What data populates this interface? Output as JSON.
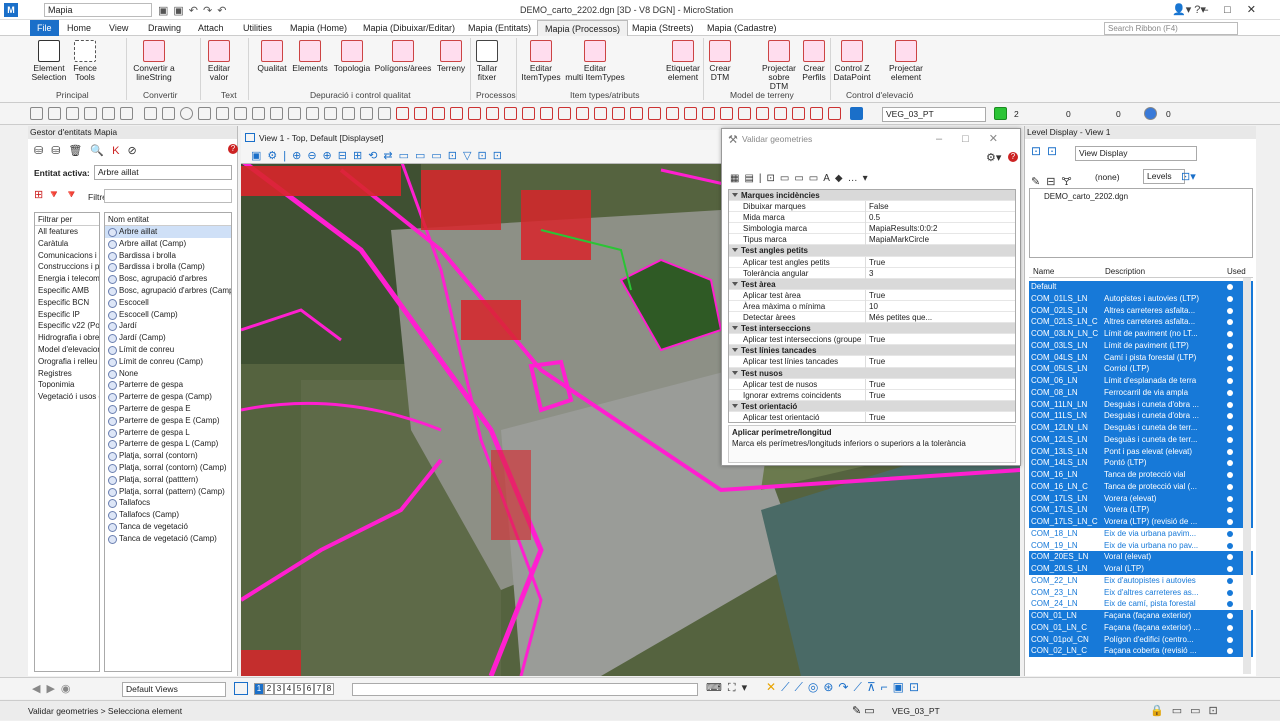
{
  "app": {
    "title": "DEMO_carto_2202.dgn [3D - V8 DGN] - MicroStation",
    "workflow": "Mapia",
    "search_placeholder": "Search Ribbon (F4)"
  },
  "tabs": [
    "File",
    "Home",
    "View",
    "Drawing",
    "Attach",
    "Utilities",
    "Mapia (Home)",
    "Mapia (Dibuixar/Editar)",
    "Mapia (Entitats)",
    "Mapia (Processos)",
    "Mapia (Streets)",
    "Mapia (Cadastre)"
  ],
  "ribbon": {
    "buttons": [
      {
        "label": "Element\nSelection"
      },
      {
        "label": "Fence\nTools"
      },
      {
        "label": "Convertir a\nlineString"
      },
      {
        "label": "Editar\nvalor"
      },
      {
        "label": "Qualitat"
      },
      {
        "label": "Elements"
      },
      {
        "label": "Topologia"
      },
      {
        "label": "Polígons/àrees"
      },
      {
        "label": "Terreny"
      },
      {
        "label": "Tallar\nfitxer"
      },
      {
        "label": "Editar\nItemTypes"
      },
      {
        "label": "Editar\nmulti ItemTypes"
      },
      {
        "label": "Etiquetar\nelement"
      },
      {
        "label": "Crear\nDTM"
      },
      {
        "label": "Projectar\nsobre DTM"
      },
      {
        "label": "Crear\nPerfils"
      },
      {
        "label": "Control Z\nDataPoint"
      },
      {
        "label": "Projectar\nelement"
      }
    ],
    "groups": [
      "Principal",
      "Convertir",
      "Text",
      "Depuració i control qualitat",
      "Processos",
      "Item types/atributs",
      "Model de terreny",
      "Control d'elevació"
    ]
  },
  "toolbar": {
    "level_combo": "VEG_03_PT",
    "weight": "2",
    "style1": "0",
    "style2": "0",
    "style3": "0"
  },
  "left_panel": {
    "title": "Gestor d'entitats Mapia",
    "entity_label": "Entitat activa:",
    "entity_value": "Arbre aillat",
    "filter_label": "Filtre:",
    "filters_header": "Filtrar per",
    "filters": [
      "All features",
      "Caràtula",
      "Comunicacions i v",
      "Construccions i po",
      "Energia i telecomu",
      "Especific AMB",
      "Especific BCN",
      "Especific IP",
      "Especific v22 (Poli",
      "Hidrografia i obres",
      "Model d'elevacion",
      "Orografia i relleu",
      "Registres",
      "Toponimia",
      "Vegetació i usos d"
    ],
    "entities_header": "Nom entitat",
    "entities": [
      "Arbre aillat",
      "Arbre aillat (Camp)",
      "Bardissa i brolla",
      "Bardissa i brolla (Camp)",
      "Bosc, agrupació d'arbres",
      "Bosc, agrupació d'arbres (Camp)",
      "Escocell",
      "Escocell (Camp)",
      "Jardí",
      "Jardí (Camp)",
      "Límit de conreu",
      "Límit de conreu (Camp)",
      "None",
      "Parterre de gespa",
      "Parterre de gespa (Camp)",
      "Parterre de gespa E",
      "Parterre de gespa E (Camp)",
      "Parterre de gespa L",
      "Parterre de gespa L (Camp)",
      "Platja, sorral (contorn)",
      "Platja, sorral (contorn) (Camp)",
      "Platja, sorral (patttern)",
      "Platja, sorral (pattern) (Camp)",
      "Tallafocs",
      "Tallafocs (Camp)",
      "Tanca de vegetació",
      "Tanca de vegetació (Camp)"
    ]
  },
  "view": {
    "title": "View 1 - Top, Default [Displayset]"
  },
  "dialog": {
    "title": "Validar geometries",
    "rows": [
      {
        "cat": true,
        "k": "Marques incidències"
      },
      {
        "k": "Dibuixar marques",
        "v": "False"
      },
      {
        "k": "Mida marca",
        "v": "0.5"
      },
      {
        "k": "Simbologia marca",
        "v": "MapiaResults:0:0:2"
      },
      {
        "k": "Tipus marca",
        "v": "MapiaMarkCircle"
      },
      {
        "cat": true,
        "k": "Test angles petits"
      },
      {
        "k": "Aplicar test angles petits",
        "v": "True"
      },
      {
        "k": "Tolerància angular",
        "v": "3"
      },
      {
        "cat": true,
        "k": "Test àrea"
      },
      {
        "k": "Aplicar test àrea",
        "v": "True"
      },
      {
        "k": "Àrea màxima o mínima",
        "v": "10"
      },
      {
        "k": "Detectar àrees",
        "v": "Més petites que..."
      },
      {
        "cat": true,
        "k": "Test interseccions"
      },
      {
        "k": "Aplicar test interseccions (groupe",
        "v": "True"
      },
      {
        "cat": true,
        "k": "Test línies tancades"
      },
      {
        "k": "Aplicar test línies tancades",
        "v": "True"
      },
      {
        "cat": true,
        "k": "Test nusos"
      },
      {
        "k": "Aplicar test de nusos",
        "v": "True"
      },
      {
        "k": "Ignorar extrems coincidents",
        "v": "True"
      },
      {
        "cat": true,
        "k": "Test orientació"
      },
      {
        "k": "Aplicar test orientació",
        "v": "True"
      }
    ],
    "desc_title": "Aplicar perímetre/longitud",
    "desc_text": "Marca els perímetres/longituds inferiors o superiors a la tolerància"
  },
  "right_panel": {
    "title": "Level Display - View 1",
    "view_combo": "View Display",
    "filter_none": "(none)",
    "levels_combo": "Levels",
    "file": "DEMO_carto_2202.dgn",
    "col_name": "Name",
    "col_desc": "Description",
    "col_used": "Used",
    "levels": [
      {
        "n": "Default",
        "d": "",
        "s": true
      },
      {
        "n": "COM_01LS_LN",
        "d": "Autopistes i autovies (LTP)",
        "s": true
      },
      {
        "n": "COM_02LS_LN",
        "d": "Altres carreteres asfalta...",
        "s": true
      },
      {
        "n": "COM_02LS_LN_C",
        "d": "Altres carreteres asfalta...",
        "s": true
      },
      {
        "n": "COM_03LN_LN_C",
        "d": "Límit de paviment (no LT...",
        "s": true
      },
      {
        "n": "COM_03LS_LN",
        "d": "Límit de paviment (LTP)",
        "s": true
      },
      {
        "n": "COM_04LS_LN",
        "d": "Camí i pista forestal (LTP)",
        "s": true
      },
      {
        "n": "COM_05LS_LN",
        "d": "Corriol (LTP)",
        "s": true
      },
      {
        "n": "COM_06_LN",
        "d": "Límit d'esplanada de terra",
        "s": true
      },
      {
        "n": "COM_08_LN",
        "d": "Ferrocarril de via ampla",
        "s": true
      },
      {
        "n": "COM_11LN_LN",
        "d": "Desguàs i cuneta d'obra ...",
        "s": true
      },
      {
        "n": "COM_11LS_LN",
        "d": "Desguàs i cuneta d'obra ...",
        "s": true
      },
      {
        "n": "COM_12LN_LN",
        "d": "Desguàs i cuneta de terr...",
        "s": true
      },
      {
        "n": "COM_12LS_LN",
        "d": "Desguàs i cuneta de terr...",
        "s": true
      },
      {
        "n": "COM_13LS_LN",
        "d": "Pont i pas elevat (elevat)",
        "s": true
      },
      {
        "n": "COM_14LS_LN",
        "d": "Pontó (LTP)",
        "s": true
      },
      {
        "n": "COM_16_LN",
        "d": "Tanca de protecció vial",
        "s": true
      },
      {
        "n": "COM_16_LN_C",
        "d": "Tanca de protecció vial (...",
        "s": true
      },
      {
        "n": "COM_17LS_LN",
        "d": "Vorera (elevat)",
        "s": true
      },
      {
        "n": "COM_17LS_LN",
        "d": "Vorera (LTP)",
        "s": true
      },
      {
        "n": "COM_17LS_LN_C",
        "d": "Vorera (LTP) (revisió de ...",
        "s": true
      },
      {
        "n": "COM_18_LN",
        "d": "Eix de via urbana pavim...",
        "s": false
      },
      {
        "n": "COM_19_LN",
        "d": "Eix de via urbana no pav...",
        "s": false
      },
      {
        "n": "COM_20ES_LN",
        "d": "Voral (elevat)",
        "s": true
      },
      {
        "n": "COM_20LS_LN",
        "d": "Voral (LTP)",
        "s": true
      },
      {
        "n": "COM_22_LN",
        "d": "Eix d'autopistes i autovies",
        "s": false
      },
      {
        "n": "COM_23_LN",
        "d": "Eix d'altres carreteres as...",
        "s": false
      },
      {
        "n": "COM_24_LN",
        "d": "Eix de camí, pista forestal",
        "s": false
      },
      {
        "n": "CON_01_LN",
        "d": "Façana (façana exterior)",
        "s": true
      },
      {
        "n": "CON_01_LN_C",
        "d": "Façana (façana exterior) ...",
        "s": true
      },
      {
        "n": "CON_01pol_CN",
        "d": "Polígon d'edifici (centro...",
        "s": true
      },
      {
        "n": "CON_02_LN_C",
        "d": "Façana coberta (revisió ...",
        "s": true
      }
    ]
  },
  "bottom": {
    "views_combo": "Default Views",
    "view_numbers": [
      "1",
      "2",
      "3",
      "4",
      "5",
      "6",
      "7",
      "8"
    ]
  },
  "status": {
    "prompt": "Validar geometries > Selecciona element",
    "level": "VEG_03_PT"
  },
  "colors": {
    "accent": "#1a6fc9",
    "selection": "#1779d8",
    "magenta": "#ff1fd0",
    "red": "#e0241f"
  }
}
